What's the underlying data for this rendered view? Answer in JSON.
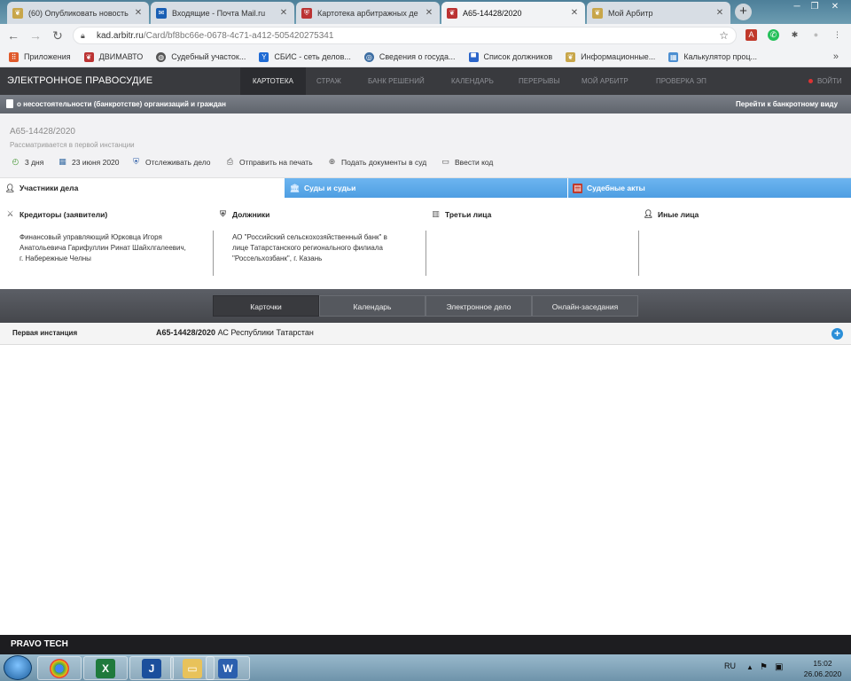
{
  "browser": {
    "tabs": [
      {
        "title": "(60) Опубликовать новость",
        "favicon": "eagle-icon",
        "color": "#c8a64a"
      },
      {
        "title": "Входящие - Почта Mail.ru",
        "favicon": "mail-icon",
        "color": "#1a5fb4"
      },
      {
        "title": "Картотека арбитражных де",
        "favicon": "shield-icon",
        "color": "#b33"
      },
      {
        "title": "А65-14428/2020",
        "favicon": "eagle-icon",
        "color": "#b33"
      },
      {
        "title": "Мой Арбитр",
        "favicon": "eagle-icon",
        "color": "#c8a64a"
      }
    ],
    "url_host": "kad.arbitr.ru",
    "url_path": "/Card/bf8bc66e-0678-4c71-a412-505420275341",
    "bookmarks": [
      {
        "label": "Приложения",
        "icon": "apps-icon",
        "color": "#e05a2b"
      },
      {
        "label": "ДВИМАВТО",
        "icon": "eagle-icon",
        "color": "#b33"
      },
      {
        "label": "Судебный участок...",
        "icon": "globe-icon",
        "color": "#555"
      },
      {
        "label": "СБИС - сеть делов...",
        "icon": "sbis-icon",
        "color": "#1f6bd4"
      },
      {
        "label": "Сведения о госуда...",
        "icon": "circle-icon",
        "color": "#3d6ea3"
      },
      {
        "label": "Список должников",
        "icon": "flag-icon",
        "color": "#2a64c9"
      },
      {
        "label": "Информационные...",
        "icon": "eagle-icon",
        "color": "#c8a64a"
      },
      {
        "label": "Калькулятор проц...",
        "icon": "calc-icon",
        "color": "#4d8fd1"
      }
    ],
    "more_bookmarks": "»"
  },
  "site": {
    "brand": "ЭЛЕКТРОННОЕ ПРАВОСУДИЕ",
    "nav": [
      "КАРТОТЕКА",
      "СТРАЖ",
      "БАНК РЕШЕНИЙ",
      "КАЛЕНДАРЬ",
      "ПЕРЕРЫВЫ",
      "МОЙ АРБИТР",
      "ПРОВЕРКА ЭП"
    ],
    "login": "ВОЙТИ",
    "category": "о несостоятельности (банкротстве) организаций и граждан",
    "category_link": "Перейти к банкротному виду"
  },
  "case": {
    "number": "А65-14428/2020",
    "instance_note": "Рассматривается в первой инстанции",
    "actions": [
      {
        "label": "3 дня",
        "icon": "clock-icon"
      },
      {
        "label": "23 июня 2020",
        "icon": "calendar-icon"
      },
      {
        "label": "Отслеживать дело",
        "icon": "shield-icon"
      },
      {
        "label": "Отправить на печать",
        "icon": "printer-icon"
      },
      {
        "label": "Подать документы в суд",
        "icon": "plus-icon"
      },
      {
        "label": "Ввести код",
        "icon": "keyboard-icon"
      }
    ]
  },
  "tabs": [
    {
      "label": "Участники дела",
      "icon": "person-icon"
    },
    {
      "label": "Суды и судьи",
      "icon": "court-icon"
    },
    {
      "label": "Судебные акты",
      "icon": "document-icon"
    }
  ],
  "participants": [
    {
      "heading": "Кредиторы (заявители)",
      "icon": "swords-icon",
      "text": [
        "Финансовый управляющий Юрковца Игоря",
        "Анатольевича Гарифуллин Ринат Шайхлгалеевич,",
        "г. Набережные Челны"
      ]
    },
    {
      "heading": "Должники",
      "icon": "shield-icon",
      "text": [
        "АО \"Российский сельскохозяйственный банк\" в",
        "лице Татарстанского регионального филиала",
        "\"Россельхозбанк\", г. Казань"
      ]
    },
    {
      "heading": "Третьи лица",
      "icon": "building-icon",
      "text": []
    },
    {
      "heading": "Иные лица",
      "icon": "person-icon",
      "text": []
    }
  ],
  "bottom_tabs": [
    "Карточки",
    "Календарь",
    "Электронное дело",
    "Онлайн-заседания"
  ],
  "instance_row": {
    "label": "Первая инстанция",
    "case": "А65-14428/2020",
    "court": " АС Республики Татарстан"
  },
  "footer": "PRAVO TECH",
  "taskbar": {
    "lang": "RU",
    "time": "15:02",
    "date": "26.06.2020"
  },
  "colors": {
    "blue_tab": "#5aa7ea",
    "nav_dark": "#393a3e",
    "accent_red": "#d33"
  }
}
